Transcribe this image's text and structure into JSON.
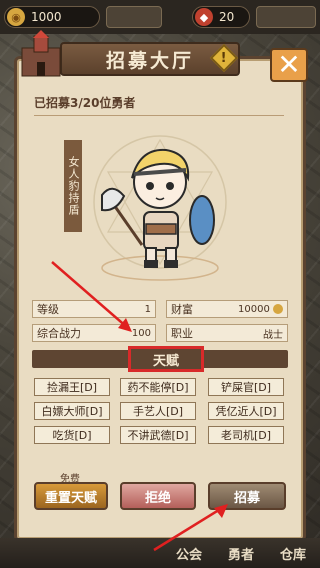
{
  "resources": {
    "coins": "1000",
    "gems": "20"
  },
  "title": "招募大厅",
  "warning_glyph": "!",
  "close_glyph": "✕",
  "recruited_text": "已招募3/20位勇者",
  "hero_class_label": "女人豹持盾",
  "stats": [
    {
      "label": "等级",
      "value": "1"
    },
    {
      "label": "财富",
      "value": "10000"
    },
    {
      "label": "综合战力",
      "value": "100"
    },
    {
      "label": "职业",
      "value": "战士"
    }
  ],
  "talent_title": "天赋",
  "traits": [
    "捡漏王[D]",
    "药不能停[D]",
    "铲屎官[D]",
    "白嫖大师[D]",
    "手艺人[D]",
    "凭亿近人[D]",
    "吃货[D]",
    "不讲武德[D]",
    "老司机[D]"
  ],
  "free_label": "免费",
  "buttons": {
    "reset": "重置天赋",
    "reject": "拒绝",
    "recruit": "招募"
  },
  "nav": [
    "公会",
    "勇者",
    "仓库"
  ],
  "colors": {
    "accent": "#d82a2a",
    "panel": "#e9dcc2",
    "frame": "#5b4330"
  }
}
